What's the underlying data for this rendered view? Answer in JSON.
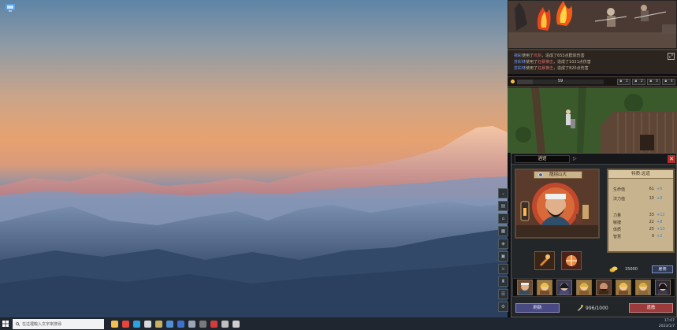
{
  "taskbar": {
    "search_placeholder": "在這裡輸入文字來搜尋",
    "clock_time": "17:07",
    "clock_date": "2023/1/7",
    "apps": [
      {
        "name": "file-explorer-icon",
        "color": "#f2c14e"
      },
      {
        "name": "chrome-icon",
        "color": "#e8453c"
      },
      {
        "name": "edge-icon",
        "color": "#2fa0e0"
      },
      {
        "name": "game-app-icon",
        "color": "#d9d9d9"
      },
      {
        "name": "game-client-icon",
        "color": "#c9b060"
      },
      {
        "name": "folder-icon",
        "color": "#4f8fd8"
      },
      {
        "name": "store-icon",
        "color": "#3c6fd0"
      },
      {
        "name": "steam-icon",
        "color": "#9aa7b4"
      },
      {
        "name": "media-icon",
        "color": "#7a7a7a"
      },
      {
        "name": "record-icon",
        "color": "#d23c3c"
      },
      {
        "name": "app-icon",
        "color": "#bfbfbf"
      },
      {
        "name": "terminal-icon",
        "color": "#cfcfcf"
      }
    ]
  },
  "game": {
    "log": [
      {
        "actor": "荷彩",
        "verb": "使用了",
        "skill": "烏劍",
        "result": "，造成了653点群体伤害"
      },
      {
        "actor": "芬彩林",
        "verb": "使用了",
        "skill": "狂暴横击",
        "result": "，造成了1021点伤害"
      },
      {
        "actor": "芬彩林",
        "verb": "使用了",
        "skill": "狂暴横击",
        "result": "，造成了820点伤害"
      }
    ],
    "status": {
      "gold_value": "59",
      "hp_fraction": 0.18,
      "slots": [
        "1",
        "2",
        "3",
        "4"
      ]
    },
    "dialog": {
      "tab_label": "酒馆",
      "hero_name": "龍拐山大",
      "stats_title": "特质:远道",
      "stats": [
        {
          "label": "生命值",
          "value": "61",
          "bonus": "+5"
        },
        {
          "label": "法力值",
          "value": "10",
          "bonus": "+0"
        },
        {
          "label": "力量",
          "value": "33",
          "bonus": "+12"
        },
        {
          "label": "敏捷",
          "value": "22",
          "bonus": "+8"
        },
        {
          "label": "体质",
          "value": "25",
          "bonus": "+10"
        },
        {
          "label": "智慧",
          "value": "9",
          "bonus": "+2"
        }
      ],
      "coin_value": "15000",
      "hire_label": "雇佣",
      "refresh_label": "刷新",
      "count_text": "996/1000",
      "dismiss_label": "遣散"
    }
  }
}
